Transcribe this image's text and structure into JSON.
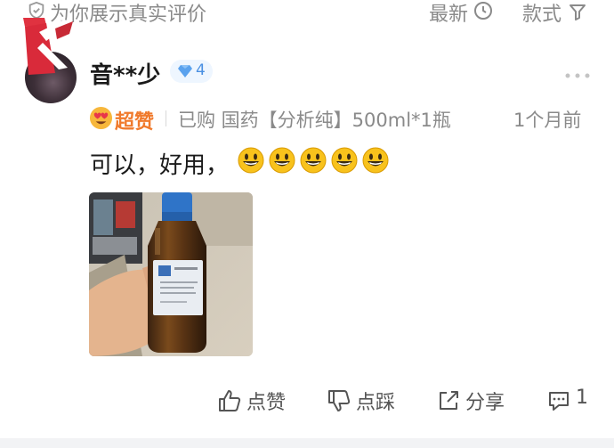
{
  "header": {
    "title": "为你展示真实评价",
    "sort_label": "最新",
    "style_label": "款式"
  },
  "review": {
    "username": "音**少",
    "level": "4",
    "rating_label": "超赞",
    "purchased": "已购 国药【分析纯】500ml*1瓶",
    "time": "1个月前",
    "text": "可以，好用，"
  },
  "actions": {
    "like": "点赞",
    "dislike": "点踩",
    "share": "分享",
    "comment_count": "1"
  },
  "colors": {
    "rating": "#f07a2c",
    "level": "#4a90e2",
    "muted": "#8a8a8a"
  }
}
